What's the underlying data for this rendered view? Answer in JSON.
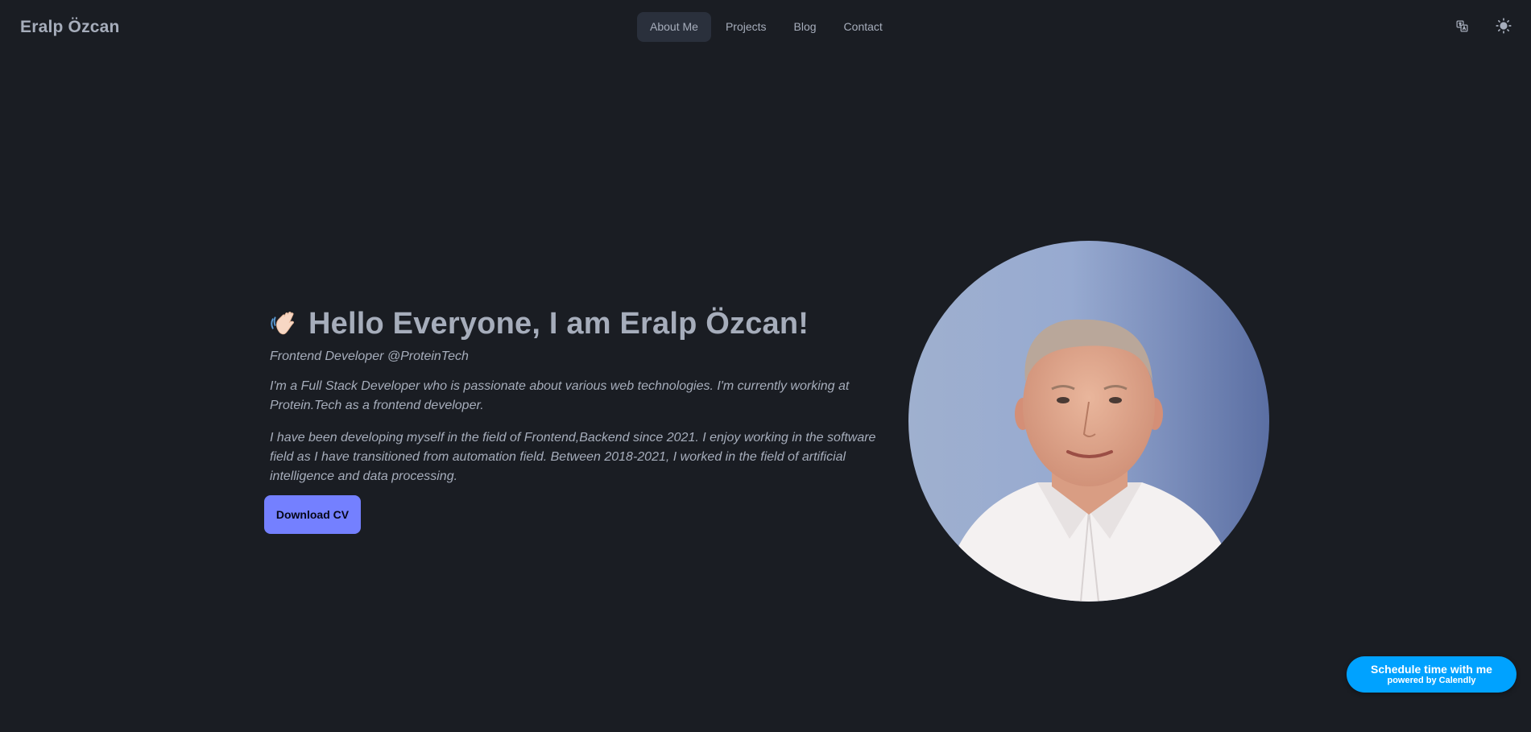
{
  "brand": "Eralp Özcan",
  "nav": {
    "items": [
      {
        "label": "About Me",
        "active": true
      },
      {
        "label": "Projects",
        "active": false
      },
      {
        "label": "Blog",
        "active": false
      },
      {
        "label": "Contact",
        "active": false
      }
    ],
    "icons": [
      "translate-icon",
      "sun-icon"
    ]
  },
  "hero": {
    "emoji_icon": "waving-hand-icon",
    "headline": "Hello Everyone, I am Eralp Özcan!",
    "subtitle": "Frontend Developer @ProteinTech",
    "paragraphs": [
      "I'm a Full Stack Developer who is passionate about various web technologies. I'm currently working at Protein.Tech as a frontend developer.",
      "I have been developing myself in the field of Frontend,Backend since 2021. I enjoy working in the software field as I have transitioned from automation field. Between 2018-2021, I worked in the field of artificial intelligence and data processing."
    ],
    "cv_button": "Download CV"
  },
  "calendly": {
    "label": "Schedule time with me",
    "sub": "powered by Calendly"
  },
  "colors": {
    "background": "#1a1d23",
    "text": "#a6adbb",
    "active_nav": "#2a303c",
    "primary": "#7480ff",
    "calendly": "#00a2ff"
  }
}
